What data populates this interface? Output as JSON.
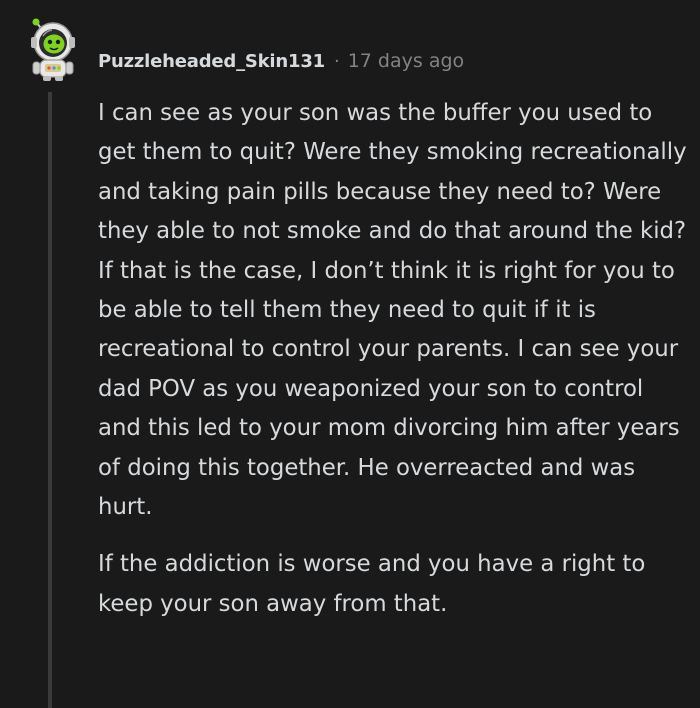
{
  "comment": {
    "author": "Puzzleheaded_Skin131",
    "separator": "·",
    "timestamp": "17 days ago",
    "avatar_icon": "snoo-avatar-icon",
    "colors": {
      "background": "#1a1a1b",
      "text": "#d7dadc",
      "meta": "#818384",
      "thread_line": "#3a3a3c",
      "avatar_accent": "#7ed321"
    },
    "paragraphs": [
      "I can see as your son was the buffer you used to get them to quit? Were they smoking recreationally and taking pain pills because they need to? Were they able to not smoke and do that around the kid? If that is the case, I don’t think it is right for you to be able to tell them they need to quit if it is recreational to control your parents. I can see your dad POV as you weaponized your son to control and this led to your mom divorcing him after years of doing this together. He overreacted and was hurt.",
      "If the addiction is worse and you have a right to keep your son away from that."
    ]
  }
}
